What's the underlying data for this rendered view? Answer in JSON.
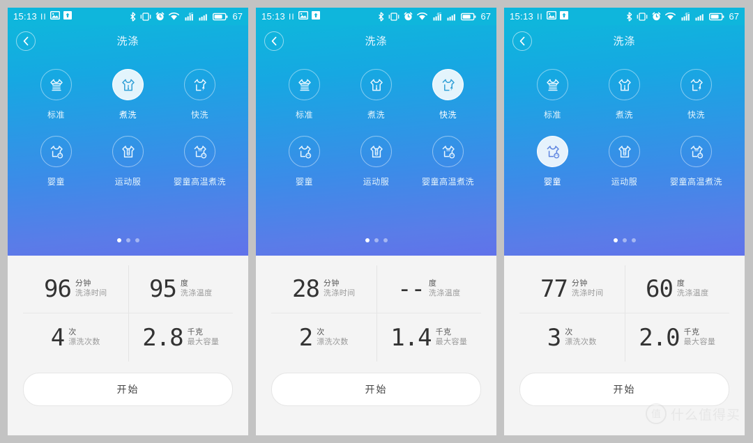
{
  "statusbar": {
    "time": "15:13",
    "pause_glyph": "II",
    "battery_percent": "67",
    "icons": [
      "image-icon",
      "upload-icon",
      "bluetooth-icon",
      "vibrate-icon",
      "alarm-icon",
      "wifi-icon",
      "signal-4g-icon",
      "signal-icon",
      "battery-icon"
    ]
  },
  "nav": {
    "back_icon": "chevron-left-icon",
    "title": "洗涤"
  },
  "programs": [
    {
      "id": "standard",
      "label": "标准",
      "icon": "shirt-wave-icon"
    },
    {
      "id": "boil",
      "label": "煮洗",
      "icon": "shirt-boil-icon"
    },
    {
      "id": "quick",
      "label": "快洗",
      "icon": "shirt-bolt-icon"
    },
    {
      "id": "baby",
      "label": "婴童",
      "icon": "shirt-baby-icon"
    },
    {
      "id": "sports",
      "label": "运动服",
      "icon": "shirt-sports-icon"
    },
    {
      "id": "baby-hot",
      "label": "婴童高温煮洗",
      "icon": "shirt-baby-hot-icon"
    }
  ],
  "stat_units": {
    "minutes": "分钟",
    "minutes_desc": "洗涤时间",
    "degrees": "度",
    "degrees_desc": "洗涤温度",
    "times": "次",
    "times_desc": "漂洗次数",
    "kilograms": "千克",
    "kilograms_desc": "最大容量"
  },
  "start_label": "开始",
  "pager": {
    "count": 3,
    "active": 0
  },
  "panels": [
    {
      "selected_program": "boil",
      "stats": {
        "time": "96",
        "temp": "95",
        "rinse": "4",
        "capacity": "2.8"
      }
    },
    {
      "selected_program": "quick",
      "stats": {
        "time": "28",
        "temp": "--",
        "rinse": "2",
        "capacity": "1.4"
      }
    },
    {
      "selected_program": "baby",
      "stats": {
        "time": "77",
        "temp": "60",
        "rinse": "3",
        "capacity": "2.0"
      }
    }
  ],
  "watermark": {
    "badge": "值",
    "text": "什么值得买"
  },
  "colors": {
    "gradient_top": "#0fb6dc",
    "gradient_bottom": "#6072ea",
    "page_bg": "#c3c3c3",
    "card_bg": "#f4f4f4",
    "accent_white": "#ffffff",
    "num_color": "#333333"
  }
}
